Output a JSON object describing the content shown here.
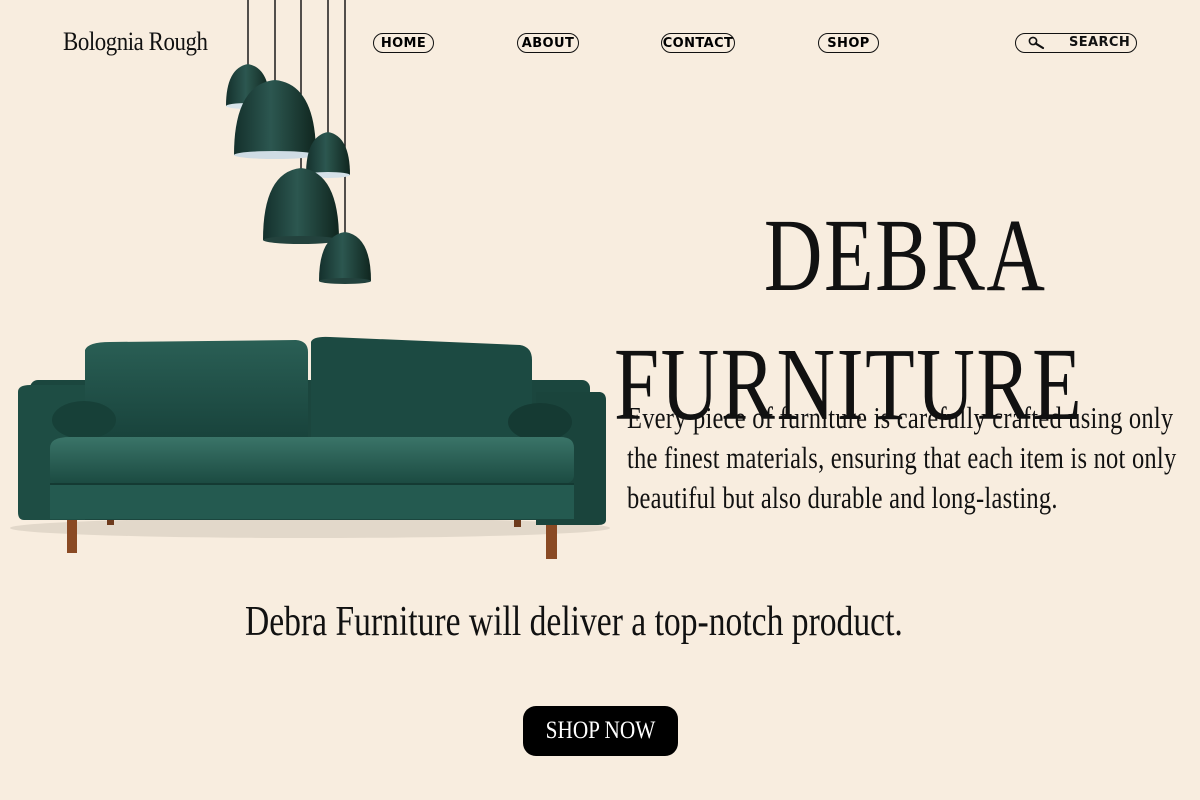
{
  "brand": "Bolognia Rough",
  "nav": {
    "home": "HOME",
    "about": "ABOUT",
    "contact": "CONTACT",
    "shop": "SHOP",
    "search": "SEARCH"
  },
  "hero": {
    "title_line1": "DEBRA",
    "title_line2": "FURNITURE",
    "description": "Every piece of furniture is carefully crafted using only the finest materials, ensuring that each item is not only beautiful but also durable and long-lasting.",
    "tagline": "Debra Furniture will deliver a top-notch product.",
    "cta": "SHOP NOW"
  },
  "colors": {
    "background": "#f8eddf",
    "sofa": "#1f5148",
    "lamp": "#1e3f3a",
    "text": "#111111",
    "button": "#000000"
  },
  "icons": [
    "search-icon"
  ]
}
